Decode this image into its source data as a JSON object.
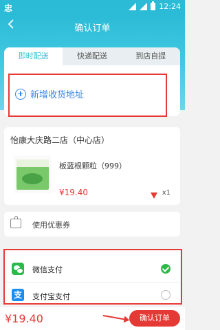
{
  "status_bar": {
    "carrier_icon": "忠",
    "time": "12:24"
  },
  "header": {
    "title": "确认订单",
    "back_icon": "chevron-left"
  },
  "tabs": [
    {
      "label": "即时配送",
      "active": true
    },
    {
      "label": "快递配送",
      "active": false
    },
    {
      "label": "到店自提",
      "active": false
    }
  ],
  "address": {
    "label": "新增收货地址"
  },
  "store": {
    "name": "怡康大庆路二店（中心店）",
    "product": {
      "image_label": "板蓝根颗粒",
      "name": "板蓝根颗粒（999）",
      "price": "¥19.40",
      "quantity": "x1"
    }
  },
  "coupon": {
    "label": "使用优惠券"
  },
  "payment": [
    {
      "label": "微信支付",
      "selected": true
    },
    {
      "label": "支付宝支付",
      "selected": false
    }
  ],
  "footer": {
    "total": "¥19.40",
    "confirm_label": "确认订单"
  },
  "colors": {
    "primary": "#2bbbd6",
    "accent_red": "#e53935",
    "link_blue": "#3a86e8",
    "wechat_green": "#2bb94a",
    "alipay_blue": "#1a8df0"
  }
}
